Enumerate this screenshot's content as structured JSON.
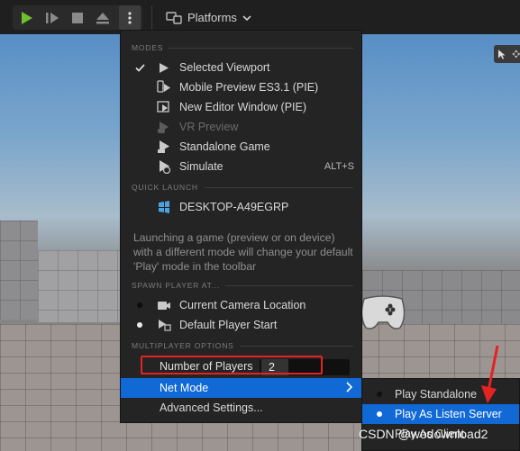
{
  "toolbar": {
    "platforms_label": "Platforms",
    "icons": [
      "play-icon",
      "step-icon",
      "stop-icon",
      "eject-icon",
      "more-options-icon",
      "platforms-icon",
      "chevron-down-icon"
    ]
  },
  "menu": {
    "sections": {
      "modes": "MODES",
      "quick_launch": "QUICK LAUNCH",
      "spawn": "SPAWN PLAYER AT...",
      "multiplayer": "MULTIPLAYER OPTIONS"
    },
    "modes": [
      {
        "label": "Selected Viewport",
        "checked": true,
        "icon": "viewport-play-icon"
      },
      {
        "label": "Mobile Preview ES3.1 (PIE)",
        "icon": "mobile-preview-icon"
      },
      {
        "label": "New Editor Window (PIE)",
        "icon": "editor-window-icon"
      },
      {
        "label": "VR Preview",
        "disabled": true,
        "icon": "vr-preview-icon"
      },
      {
        "label": "Standalone Game",
        "icon": "standalone-icon"
      },
      {
        "label": "Simulate",
        "shortcut": "ALT+S",
        "icon": "simulate-icon"
      }
    ],
    "quick_launch": [
      {
        "label": "DESKTOP-A49EGRP",
        "icon": "desktop-device-icon"
      }
    ],
    "description": "Launching a game (preview or on device) with a different mode will change your default 'Play' mode in the toolbar",
    "spawn": [
      {
        "label": "Current Camera Location",
        "radio": "empty"
      },
      {
        "label": "Default Player Start",
        "radio": "selected"
      }
    ],
    "number_of_players_label": "Number of Players",
    "number_of_players_value": "2",
    "net_mode_label": "Net Mode",
    "advanced_label": "Advanced Settings..."
  },
  "net_mode_submenu": [
    {
      "label": "Play Standalone",
      "selected": false
    },
    {
      "label": "Play As Listen Server",
      "selected": true
    },
    {
      "label": "Play As Client",
      "selected": false
    }
  ],
  "watermark": "CSDN @wodownload2",
  "colors": {
    "highlight": "#1169d6",
    "annotation_red": "#e52222",
    "play_green": "#6fbf2f"
  }
}
